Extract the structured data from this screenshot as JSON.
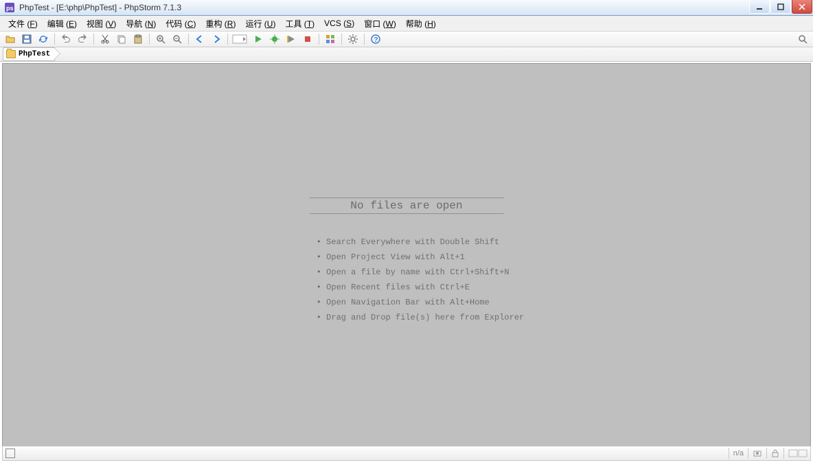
{
  "titlebar": {
    "text": "PhpTest - [E:\\php\\PhpTest] - PhpStorm 7.1.3"
  },
  "menu": {
    "items": [
      {
        "label": "文件",
        "mnemonic": "F"
      },
      {
        "label": "编辑",
        "mnemonic": "E"
      },
      {
        "label": "视图",
        "mnemonic": "V"
      },
      {
        "label": "导航",
        "mnemonic": "N"
      },
      {
        "label": "代码",
        "mnemonic": "C"
      },
      {
        "label": "重构",
        "mnemonic": "R"
      },
      {
        "label": "运行",
        "mnemonic": "U"
      },
      {
        "label": "工具",
        "mnemonic": "T"
      },
      {
        "label": "VCS",
        "mnemonic": "S"
      },
      {
        "label": "窗口",
        "mnemonic": "W"
      },
      {
        "label": "帮助",
        "mnemonic": "H"
      }
    ]
  },
  "toolbar": {
    "icons": [
      "open-icon",
      "save-icon",
      "sync-icon",
      "sep",
      "undo-icon",
      "redo-icon",
      "sep",
      "cut-icon",
      "copy-icon",
      "paste-icon",
      "sep",
      "zoom-in-icon",
      "zoom-out-icon",
      "sep",
      "back-icon",
      "forward-icon",
      "sep",
      "run-config-icon",
      "run-icon",
      "debug-icon",
      "coverage-icon",
      "stop-icon",
      "sep",
      "structure-icon",
      "sep",
      "settings-icon",
      "sep",
      "help-icon"
    ]
  },
  "breadcrumb": {
    "project": "PhpTest"
  },
  "empty_editor": {
    "title": "No files are open",
    "hints": [
      "Search Everywhere with Double Shift",
      "Open Project View with Alt+1",
      "Open a file by name with Ctrl+Shift+N",
      "Open Recent files with Ctrl+E",
      "Open Navigation Bar with Alt+Home",
      "Drag and Drop file(s) here from Explorer"
    ]
  },
  "status": {
    "insert_mode": "n/a"
  }
}
